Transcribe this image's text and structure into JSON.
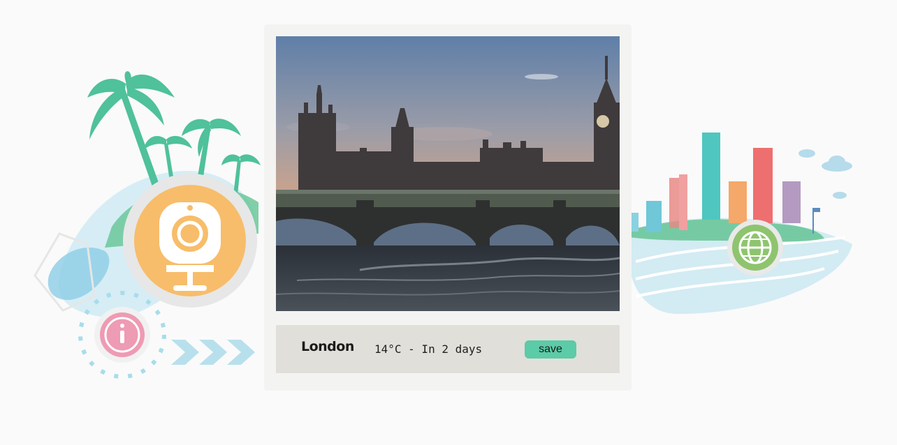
{
  "weather_card": {
    "city": "London",
    "forecast": "14°C - In 2 days",
    "save_label": "save"
  },
  "colors": {
    "accent": "#5ccba7",
    "card_background": "#f3f3f1",
    "info_bar_background": "#e0dfda",
    "palm_green": "#4fc19b",
    "webcam_orange": "#f7bd6a",
    "info_pink": "#ee9bb4",
    "globe_green": "#8fc46f"
  },
  "illustration_icons": [
    "palm-tree-icon",
    "webcam-icon",
    "info-icon",
    "globe-icon",
    "city-skyline-icon",
    "cloud-icon",
    "chevron-right-icon"
  ]
}
